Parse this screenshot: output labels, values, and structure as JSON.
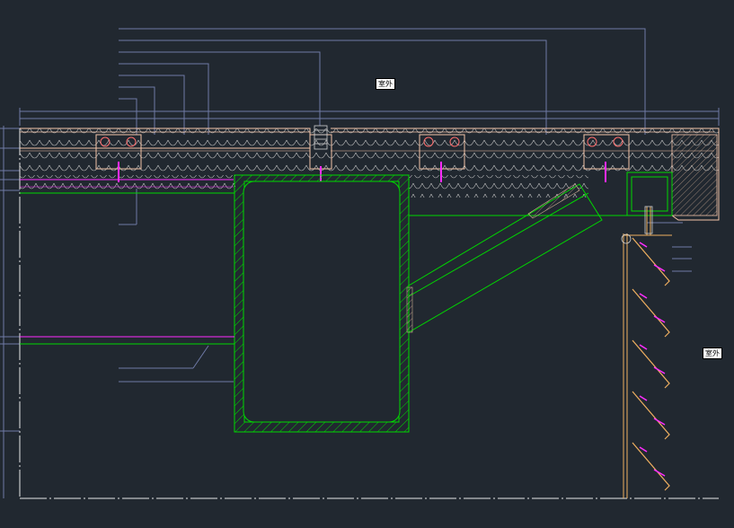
{
  "drawing": {
    "background": "#212830",
    "colors": {
      "leader": "#6f7aa6",
      "steel": "#00d800",
      "panel": "#f4c4a8",
      "fixing": "#ff2cff",
      "white": "#e8e8e8",
      "gray": "#9a9a9a",
      "orange": "#f0b060"
    },
    "labels": {
      "outdoor_top": "室外",
      "outdoor_right": "室外"
    }
  }
}
